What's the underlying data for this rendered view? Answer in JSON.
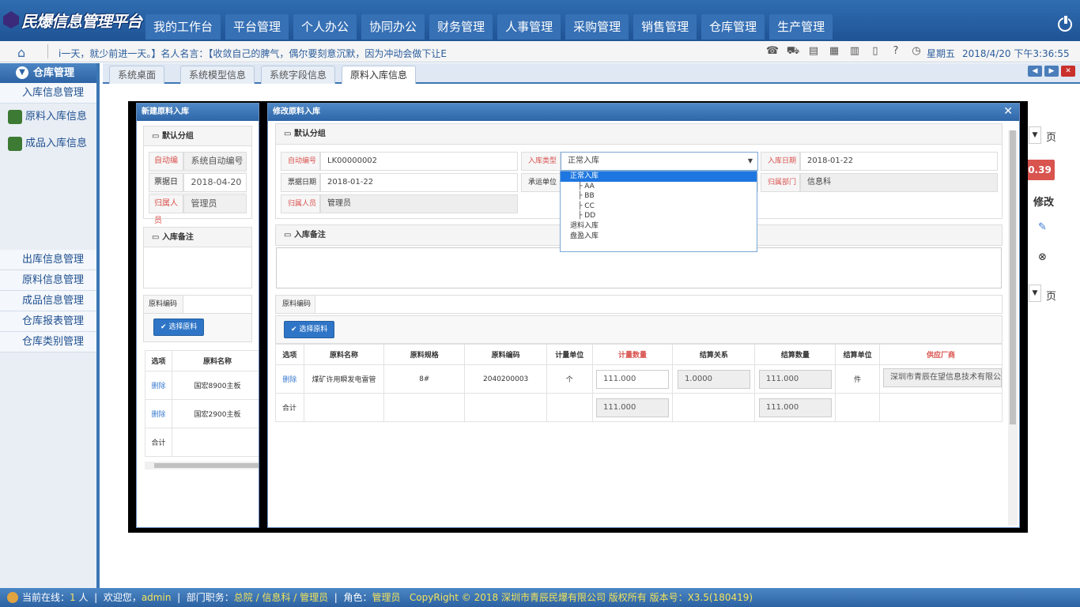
{
  "app": {
    "title": "民爆信息管理平台"
  },
  "nav": [
    "我的工作台",
    "平台管理",
    "个人办公",
    "协同办公",
    "财务管理",
    "人事管理",
    "采购管理",
    "销售管理",
    "仓库管理",
    "生产管理"
  ],
  "infobar": {
    "marquee": "i一天，就少前进一天。】名人名言：【收敛自己的脾气，偶尔要刻意沉默，因为冲动会做下让E",
    "weekday": "星期五",
    "datetime": "2018/4/20 下午3:36:55"
  },
  "sidebar": {
    "title": "仓库管理",
    "items": [
      "入库信息管理"
    ],
    "subitems": [
      "原料入库信息",
      "成品入库信息"
    ],
    "items_bottom": [
      "出库信息管理",
      "原料信息管理",
      "成品信息管理",
      "仓库报表管理",
      "仓库类别管理"
    ]
  },
  "tabs": [
    "系统桌面",
    "系统模型信息",
    "系统字段信息",
    "原料入库信息"
  ],
  "background": {
    "page_suffix": "页",
    "badge": "0.39",
    "edit_header": "修改"
  },
  "dialog_new": {
    "title": "新建原料入库",
    "group": "默认分组",
    "fields": [
      {
        "label": "自动编号",
        "value": "系统自动编号"
      },
      {
        "label": "票据日期",
        "value": "2018-04-20"
      },
      {
        "label": "归属人员",
        "value": "管理员"
      }
    ],
    "remark_group": "入库备注",
    "material_code_label": "原料编码",
    "pick_button": "✔ 选择原料",
    "columns": [
      "选项",
      "原料名称"
    ],
    "rows": [
      {
        "op": "删除",
        "name": "国宏8900主板"
      },
      {
        "op": "删除",
        "name": "国宏2900主板"
      }
    ],
    "total_label": "合计"
  },
  "dialog_edit": {
    "title": "修改原料入库",
    "group": "默认分组",
    "fields": {
      "auto_no_label": "自动编号",
      "auto_no": "LK00000002",
      "type_label": "入库类型",
      "type": "正常入库",
      "in_date_label": "入库日期",
      "in_date": "2018-01-22",
      "bill_date_label": "票据日期",
      "bill_date": "2018-01-22",
      "carrier_label": "承运单位",
      "dept_label": "归属部门",
      "dept": "信息科",
      "person_label": "归属人员",
      "person": "管理员"
    },
    "type_options": [
      "正常入库",
      "├ AA",
      "├ BB",
      "├ CC",
      "├ DD",
      "退料入库",
      "盘盈入库"
    ],
    "remark_group": "入库备注",
    "material_code_label": "原料编码",
    "pick_button": "✔ 选择原料",
    "columns": [
      "选项",
      "原料名称",
      "原料规格",
      "原料编码",
      "计量单位",
      "计量数量",
      "结算关系",
      "结算数量",
      "结算单位",
      "供应厂商"
    ],
    "row": {
      "op": "删除",
      "name": "煤矿许用瞬发电雷管",
      "spec": "8#",
      "code": "2040200003",
      "unit": "个",
      "qty": "111.000",
      "ratio": "1.0000",
      "settle_qty": "111.000",
      "settle_unit": "件",
      "supplier": "深圳市青辰在望信息技术有限公"
    },
    "total_label": "合计",
    "total_qty": "111.000",
    "total_settle": "111.000"
  },
  "footer": {
    "online_label": "当前在线：",
    "online_count": "1",
    "online_unit": "人",
    "welcome": "欢迎您，",
    "user": "admin",
    "duty_label": "部门职务：",
    "duty": "总院 / 信息科 / 管理员",
    "role_label": "角色：",
    "role": "管理员",
    "copyright": "CopyRight © 2018  深圳市青辰民爆有限公司 版权所有 版本号：X3.5(180419)"
  },
  "colors": {
    "primary": "#2d63a4",
    "required": "#d9534f",
    "selected": "#1e77e0"
  }
}
